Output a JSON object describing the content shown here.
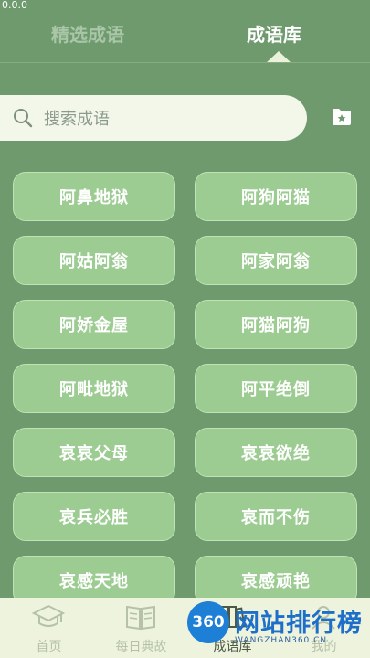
{
  "status_text": "0.0.0",
  "tabs": [
    {
      "label": "精选成语",
      "active": false
    },
    {
      "label": "成语库",
      "active": true
    }
  ],
  "search": {
    "placeholder": "搜索成语",
    "icon": "search-icon"
  },
  "favorite_icon": "folder-star-icon",
  "idioms": [
    "阿鼻地狱",
    "阿狗阿猫",
    "阿姑阿翁",
    "阿家阿翁",
    "阿娇金屋",
    "阿猫阿狗",
    "阿毗地狱",
    "阿平绝倒",
    "哀哀父母",
    "哀哀欲绝",
    "哀兵必胜",
    "哀而不伤",
    "哀感天地",
    "哀感顽艳"
  ],
  "bottom_nav": [
    {
      "label": "首页",
      "icon": "graduation-cap-icon"
    },
    {
      "label": "每日典故",
      "icon": "book-icon"
    },
    {
      "label": "成语库",
      "icon": "library-icon",
      "active": true
    },
    {
      "label": "我的",
      "icon": "person-icon"
    }
  ],
  "watermark": {
    "badge": "360",
    "title": "网站排行榜",
    "subtitle": "WANGZHAN360.CN"
  },
  "colors": {
    "background": "#6f9a6e",
    "item": "#9ccc92",
    "bottom_bar": "#eef3de"
  }
}
